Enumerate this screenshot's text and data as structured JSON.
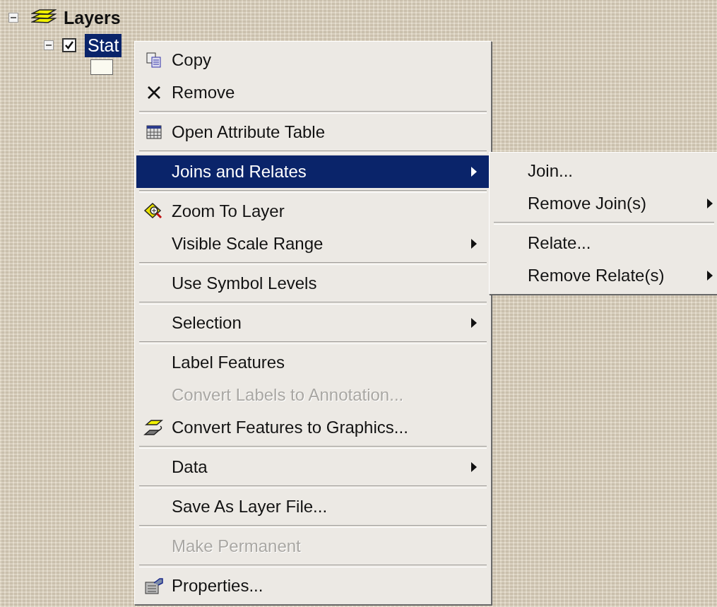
{
  "tree": {
    "label": "Layers",
    "expanded": true,
    "children": [
      {
        "label": "Stat",
        "expanded": true,
        "checked": true,
        "selected": true,
        "children": [
          {
            "kind": "symbol"
          }
        ]
      }
    ]
  },
  "context_menu": {
    "groups": [
      {
        "items": [
          {
            "kind": "copy",
            "label": "Copy",
            "disabled": false,
            "selected": false,
            "has_submenu": false
          },
          {
            "kind": "remove",
            "label": "Remove",
            "disabled": false,
            "selected": false,
            "has_submenu": false
          }
        ]
      },
      {
        "items": [
          {
            "kind": "table",
            "label": "Open Attribute Table",
            "disabled": false,
            "selected": false,
            "has_submenu": false
          }
        ]
      },
      {
        "items": [
          {
            "kind": "plain",
            "label": "Joins and Relates",
            "disabled": false,
            "selected": true,
            "has_submenu": true
          }
        ]
      },
      {
        "items": [
          {
            "kind": "zoom",
            "label": "Zoom To Layer",
            "disabled": false,
            "selected": false,
            "has_submenu": false
          },
          {
            "kind": "plain",
            "label": "Visible Scale Range",
            "disabled": false,
            "selected": false,
            "has_submenu": true
          }
        ]
      },
      {
        "items": [
          {
            "kind": "plain",
            "label": "Use Symbol Levels",
            "disabled": false,
            "selected": false,
            "has_submenu": false
          }
        ]
      },
      {
        "items": [
          {
            "kind": "plain",
            "label": "Selection",
            "disabled": false,
            "selected": false,
            "has_submenu": true
          }
        ]
      },
      {
        "items": [
          {
            "kind": "plain",
            "label": "Label Features",
            "disabled": false,
            "selected": false,
            "has_submenu": false
          },
          {
            "kind": "plain",
            "label": "Convert Labels to Annotation...",
            "disabled": true,
            "selected": false,
            "has_submenu": false
          },
          {
            "kind": "convert",
            "label": "Convert Features to Graphics...",
            "disabled": false,
            "selected": false,
            "has_submenu": false
          }
        ]
      },
      {
        "items": [
          {
            "kind": "plain",
            "label": "Data",
            "disabled": false,
            "selected": false,
            "has_submenu": true
          }
        ]
      },
      {
        "items": [
          {
            "kind": "plain",
            "label": "Save As Layer File...",
            "disabled": false,
            "selected": false,
            "has_submenu": false
          }
        ]
      },
      {
        "items": [
          {
            "kind": "plain",
            "label": "Make Permanent",
            "disabled": true,
            "selected": false,
            "has_submenu": false
          }
        ]
      },
      {
        "items": [
          {
            "kind": "properties",
            "label": "Properties...",
            "disabled": false,
            "selected": false,
            "has_submenu": false
          }
        ]
      }
    ]
  },
  "submenu": {
    "groups": [
      {
        "items": [
          {
            "label": "Join...",
            "has_submenu": false
          },
          {
            "label": "Remove Join(s)",
            "has_submenu": true
          }
        ]
      },
      {
        "items": [
          {
            "label": "Relate...",
            "has_submenu": false
          },
          {
            "label": "Remove Relate(s)",
            "has_submenu": true
          }
        ]
      }
    ]
  }
}
